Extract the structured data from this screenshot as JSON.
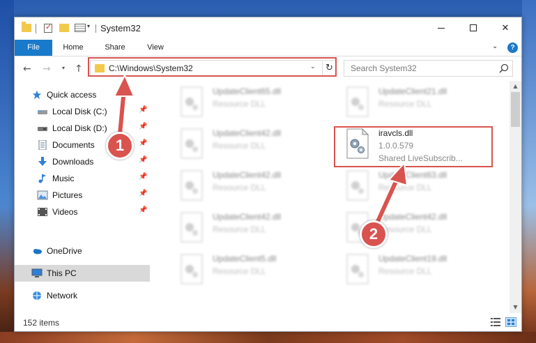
{
  "window": {
    "title": "System32"
  },
  "ribbon": {
    "tabs": [
      {
        "label": "File"
      },
      {
        "label": "Home"
      },
      {
        "label": "Share"
      },
      {
        "label": "View"
      }
    ],
    "help_label": "?"
  },
  "address": {
    "path": "C:\\Windows\\System32",
    "search_placeholder": "Search System32"
  },
  "sidebar": {
    "items": [
      {
        "label": "Quick access",
        "icon": "star-icon"
      },
      {
        "label": "Local Disk (C:)",
        "icon": "drive-icon",
        "pinned": true
      },
      {
        "label": "Local Disk (D:)",
        "icon": "drive-icon",
        "pinned": true
      },
      {
        "label": "Documents",
        "icon": "documents-icon",
        "pinned": true
      },
      {
        "label": "Downloads",
        "icon": "downloads-icon",
        "pinned": true
      },
      {
        "label": "Music",
        "icon": "music-icon",
        "pinned": true
      },
      {
        "label": "Pictures",
        "icon": "pictures-icon",
        "pinned": true
      },
      {
        "label": "Videos",
        "icon": "videos-icon",
        "pinned": true
      },
      {
        "label": "OneDrive",
        "icon": "cloud-icon"
      },
      {
        "label": "This PC",
        "icon": "computer-icon",
        "selected": true
      },
      {
        "label": "Network",
        "icon": "network-icon"
      }
    ]
  },
  "files": [
    {
      "name": "UpdateClient65.dll",
      "desc": "Resource DLL"
    },
    {
      "name": "UpdateClient21.dll",
      "desc": "Resource DLL"
    },
    {
      "name": "UpdateClient42.dll",
      "desc": "Resource DLL"
    },
    {
      "name": "iravcls.dll",
      "desc": "1.0.0.579",
      "desc2": "Shared LiveSubscrib..."
    },
    {
      "name": "UpdateClient42.dll",
      "desc": "Resource DLL"
    },
    {
      "name": "UpdateClient63.dll",
      "desc": "Resource DLL"
    },
    {
      "name": "UpdateClient42.dll",
      "desc": "Resource DLL"
    },
    {
      "name": "UpdateClient42.dll",
      "desc": "Resource DLL"
    },
    {
      "name": "UpdateClient5.dll",
      "desc": "Resource DLL"
    },
    {
      "name": "UpdateClient19.dll",
      "desc": "Resource DLL"
    }
  ],
  "status": {
    "item_count": "152 items"
  },
  "callouts": {
    "one": "1",
    "two": "2"
  },
  "colors": {
    "accent": "#1979ca",
    "highlight": "#d9534f"
  }
}
